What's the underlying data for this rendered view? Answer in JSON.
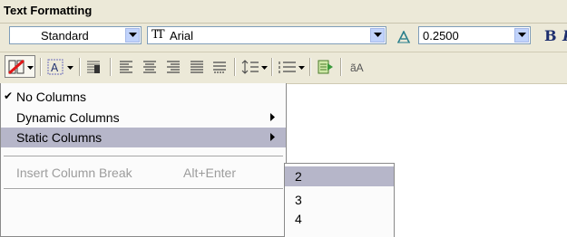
{
  "window": {
    "title": "Text Formatting"
  },
  "toolbar": {
    "style": {
      "value": "Standard"
    },
    "font": {
      "value": "Arial",
      "icon": "truetype-font-icon"
    },
    "height": {
      "value": "0.2500"
    },
    "bold_label": "B",
    "italic_label": "I",
    "case_label": "ãA",
    "buttons": [
      "columns-icon",
      "mtext-justification-icon",
      "paragraph-icon",
      "align-left-icon",
      "align-center-icon",
      "align-right-icon",
      "justify-icon",
      "distribute-icon",
      "line-spacing-icon",
      "numbering-icon",
      "insert-field-icon",
      "case-icon"
    ]
  },
  "columns_menu": {
    "items": [
      {
        "label": "No Columns",
        "checked": true
      },
      {
        "label": "Dynamic Columns",
        "submenu": true
      },
      {
        "label": "Static Columns",
        "submenu": true,
        "highlighted": true
      },
      {
        "label": "Insert Column Break",
        "shortcut": "Alt+Enter",
        "disabled": true
      }
    ]
  },
  "static_columns_submenu": {
    "items": [
      "2",
      "3",
      "4"
    ],
    "highlighted": "2"
  }
}
